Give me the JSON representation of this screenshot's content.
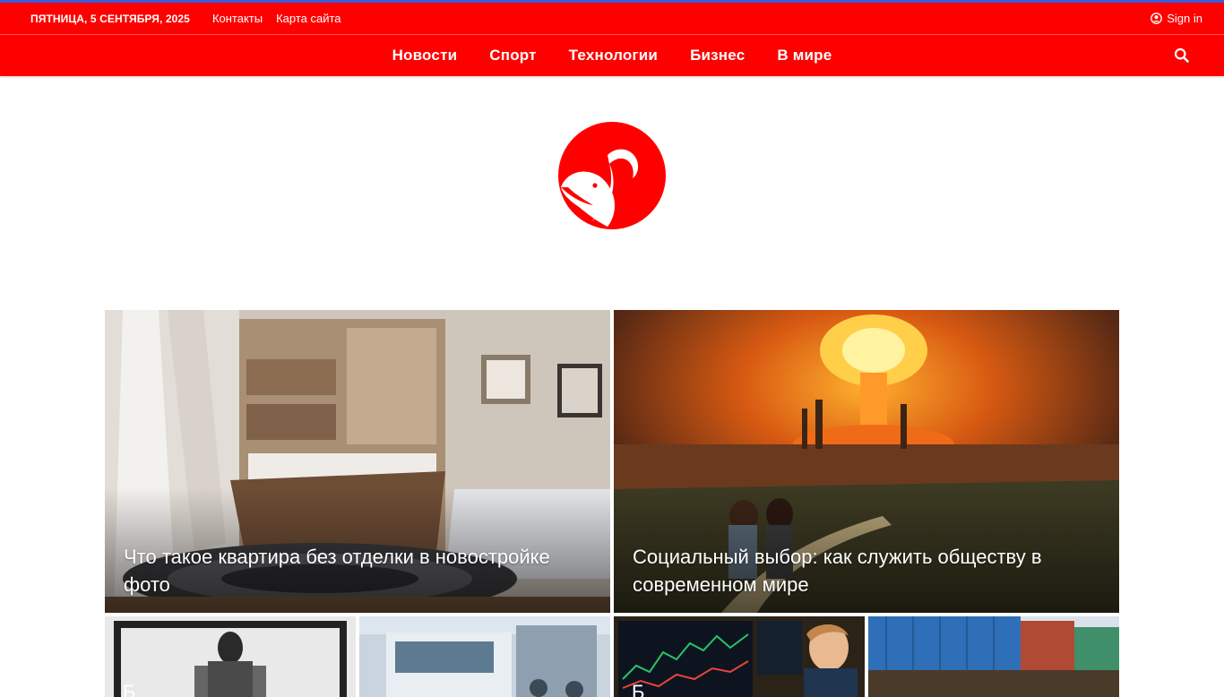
{
  "topbar": {
    "date": "ПЯТНИЦА, 5 СЕНТЯБРЯ, 2025",
    "links": [
      "Контакты",
      "Карта сайта"
    ],
    "signin": "Sign in"
  },
  "nav": {
    "items": [
      "Новости",
      "Спорт",
      "Технологии",
      "Бизнес",
      "В мире"
    ]
  },
  "colors": {
    "brand_red": "#ff0000",
    "top_accent": "#3b5bdb"
  },
  "featured": [
    {
      "title": "Что такое квартира без отделки в новостройке фото"
    },
    {
      "title": "Социальный выбор: как служить обществу в современном мире"
    }
  ],
  "small_cards": [
    {
      "title": "Б"
    },
    {
      "title": ""
    },
    {
      "title": "Б"
    },
    {
      "title": ""
    }
  ]
}
